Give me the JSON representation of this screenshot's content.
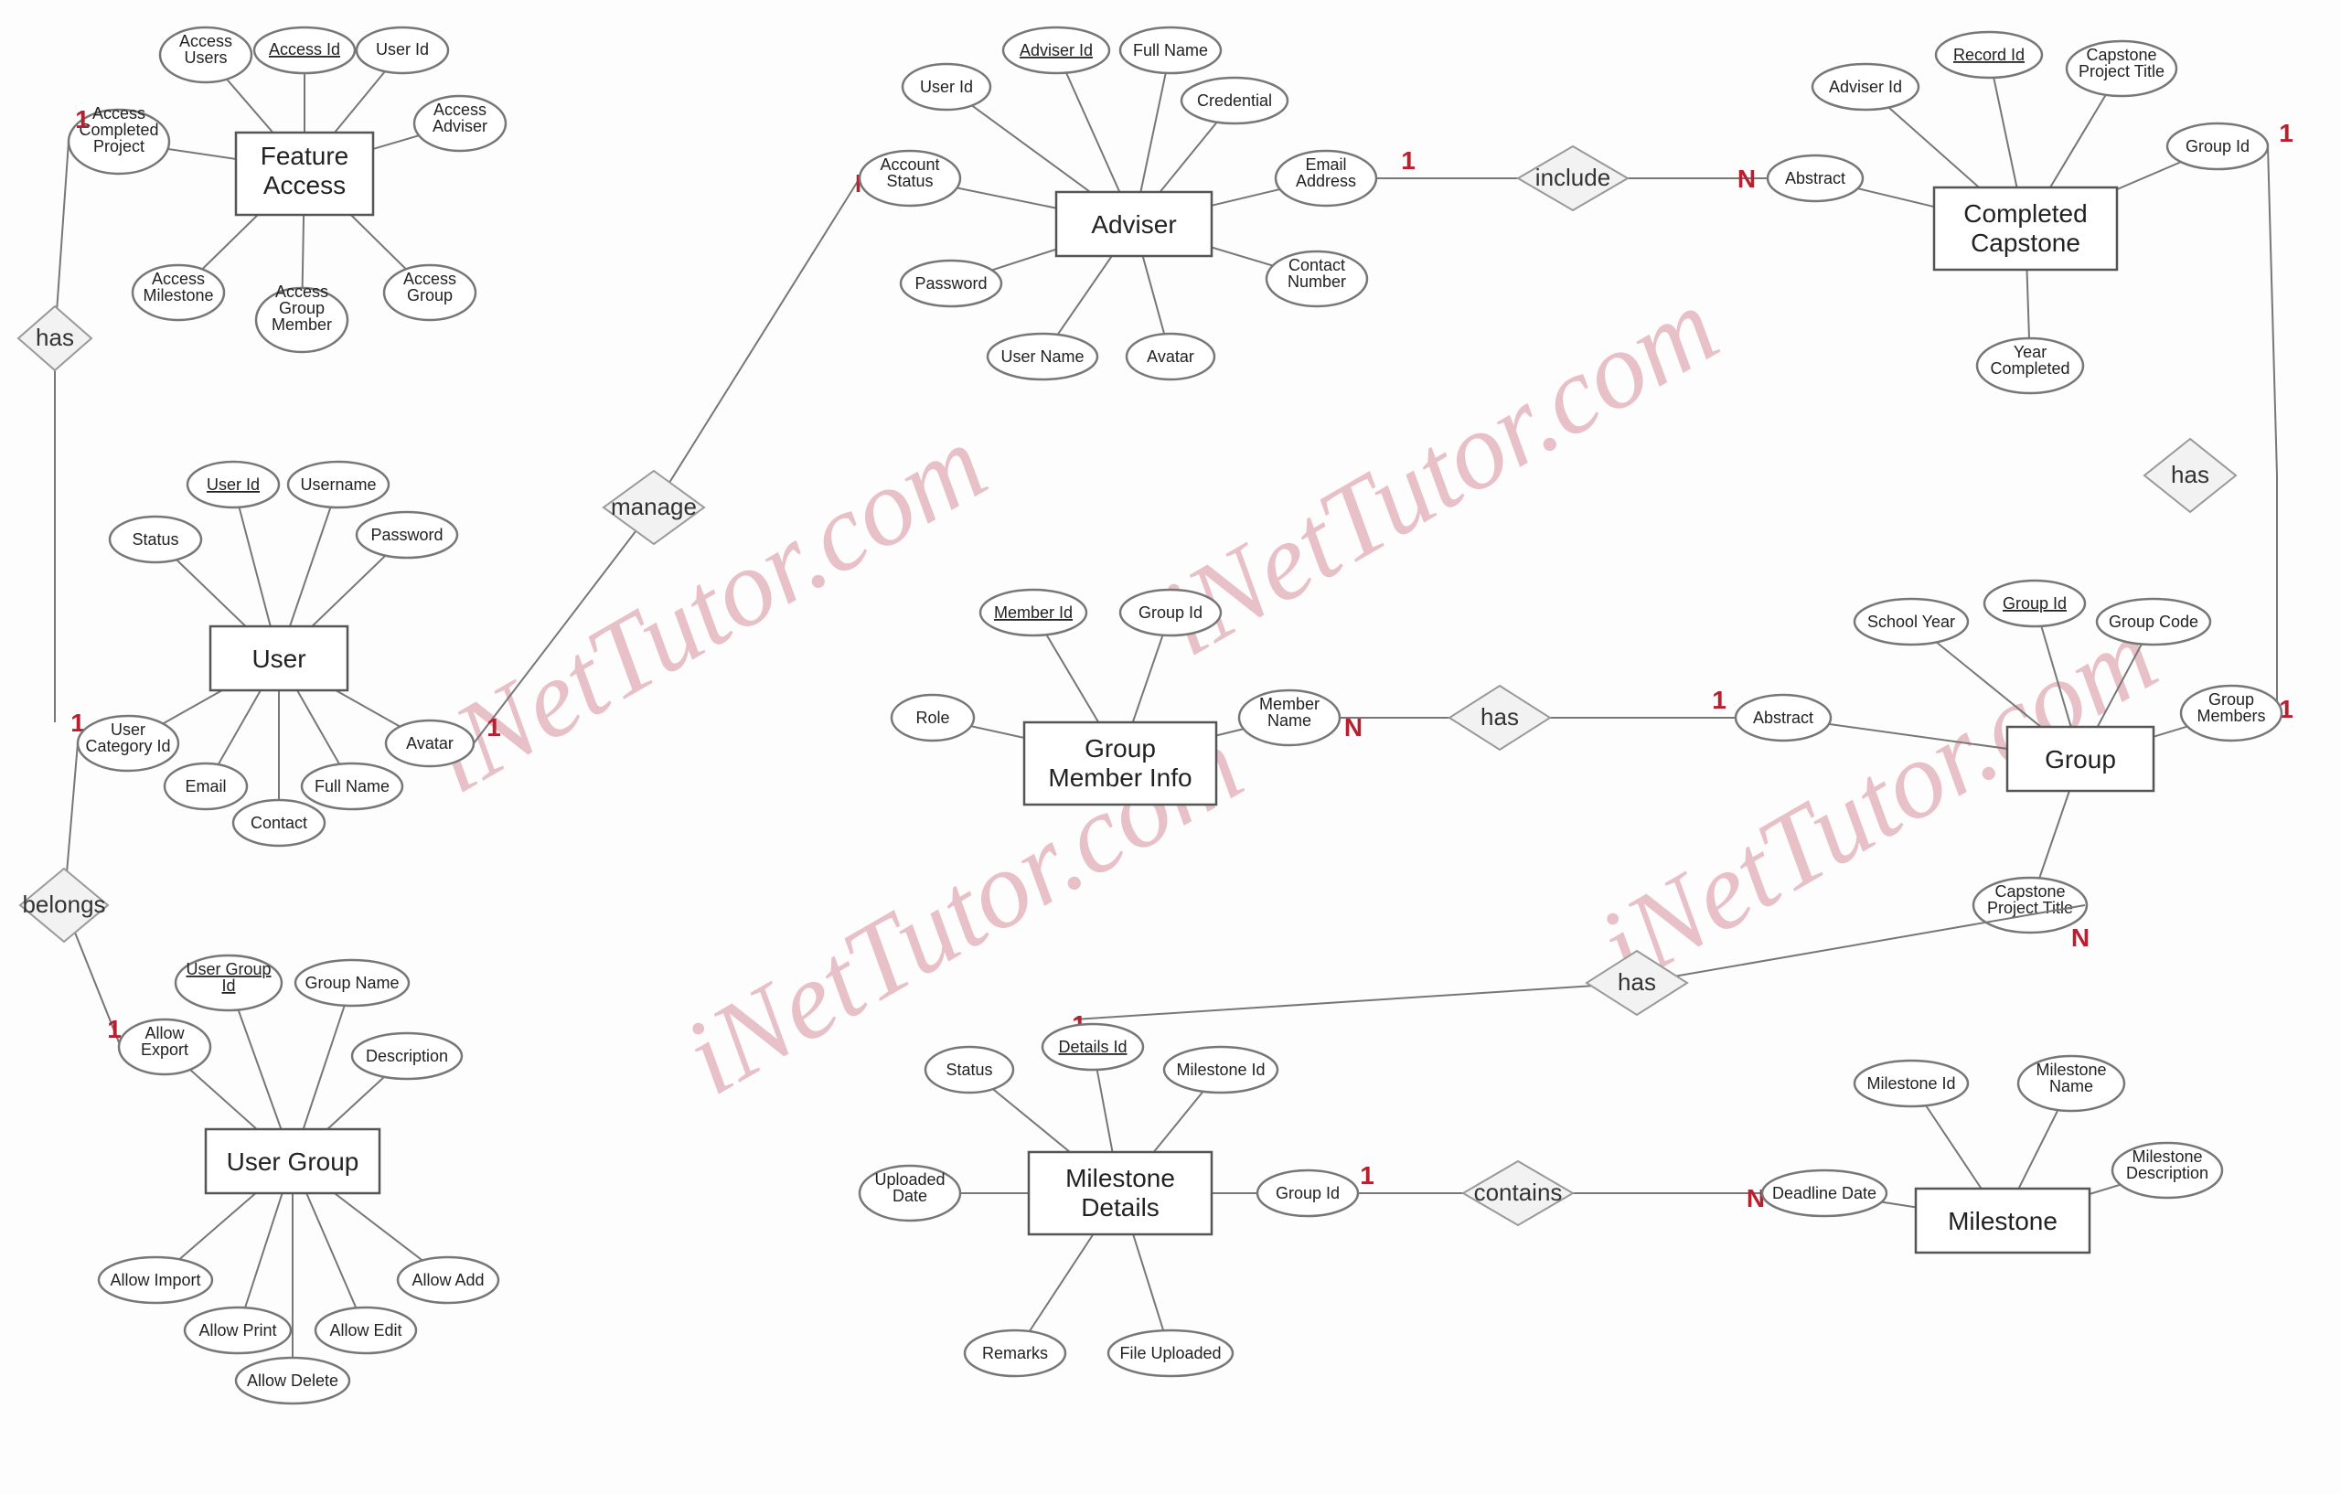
{
  "watermark": "iNetTutor.com",
  "entities": {
    "feature_access": "Feature\nAccess",
    "user": "User",
    "user_group": "User Group",
    "adviser": "Adviser",
    "completed_capstone": "Completed\nCapstone",
    "group_member_info": "Group\nMember Info",
    "group": "Group",
    "milestone_details": "Milestone\nDetails",
    "milestone": "Milestone"
  },
  "relationships": {
    "has1": "has",
    "belongs": "belongs",
    "manage": "manage",
    "include": "include",
    "has2": "has",
    "has3": "has",
    "has4": "has",
    "contains": "contains"
  },
  "attrs": {
    "fa_access_users": "Access\nUsers",
    "fa_access_id": "Access Id",
    "fa_user_id": "User Id",
    "fa_access_adviser": "Access\nAdviser",
    "fa_access_completed": "Access\nCompleted\nProject",
    "fa_access_milestone": "Access\nMilestone",
    "fa_access_group_member": "Access\nGroup\nMember",
    "fa_access_group": "Access\nGroup",
    "u_user_id": "User Id",
    "u_username": "Username",
    "u_password": "Password",
    "u_status": "Status",
    "u_user_cat": "User\nCategory Id",
    "u_email": "Email",
    "u_contact": "Contact",
    "u_fullname": "Full Name",
    "u_avatar": "Avatar",
    "ug_user_group_id": "User Group\nId",
    "ug_group_name": "Group Name",
    "ug_description": "Description",
    "ug_allow_export": "Allow\nExport",
    "ug_allow_import": "Allow Import",
    "ug_allow_print": "Allow Print",
    "ug_allow_delete": "Allow Delete",
    "ug_allow_edit": "Allow Edit",
    "ug_allow_add": "Allow Add",
    "adv_adviser_id": "Adviser Id",
    "adv_full_name": "Full Name",
    "adv_credential": "Credential",
    "adv_email": "Email\nAddress",
    "adv_contact": "Contact\nNumber",
    "adv_avatar": "Avatar",
    "adv_user_name": "User Name",
    "adv_password": "Password",
    "adv_account_status": "Account\nStatus",
    "adv_user_id": "User Id",
    "cc_record_id": "Record Id",
    "cc_title": "Capstone\nProject Title",
    "cc_group_id": "Group Id",
    "cc_year": "Year\nCompleted",
    "cc_abstract": "Abstract",
    "cc_adviser_id": "Adviser Id",
    "gmi_member_id": "Member Id",
    "gmi_group_id": "Group Id",
    "gmi_member_name": "Member\nName",
    "gmi_role": "Role",
    "g_group_id": "Group Id",
    "g_group_code": "Group Code",
    "g_group_members": "Group\nMembers",
    "g_school_year": "School Year",
    "g_abstract": "Abstract",
    "g_title": "Capstone\nProject Title",
    "md_details_id": "Details Id",
    "md_milestone_id": "Milestone Id",
    "md_group_id": "Group Id",
    "md_status": "Status",
    "md_uploaded_date": "Uploaded\nDate",
    "md_remarks": "Remarks",
    "md_file": "File Uploaded",
    "m_milestone_id": "Milestone Id",
    "m_name": "Milestone\nName",
    "m_desc": "Milestone\nDescription",
    "m_deadline": "Deadline Date"
  },
  "card": {
    "one": "1",
    "n": "N"
  }
}
